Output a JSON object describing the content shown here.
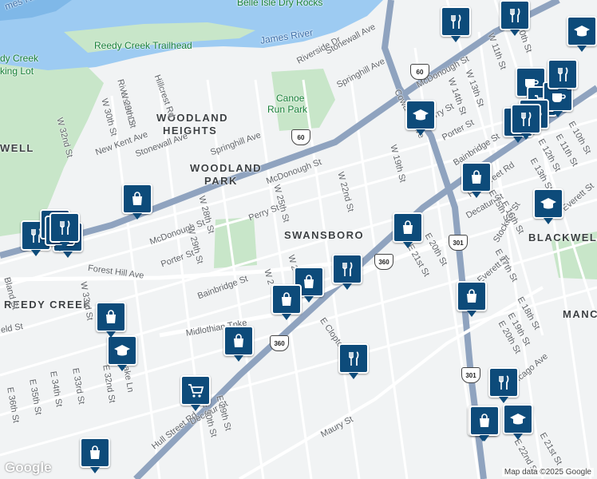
{
  "areas": [
    "WOODLAND HEIGHTS",
    "WOODLAND PARK",
    "SWANSBORO",
    "REEDY CREEK",
    "BLACKWELL",
    "MANC",
    "WELL"
  ],
  "pois": [
    "Reedy Creek Trailhead",
    "dy Creek",
    "king Lot",
    "Canoe Run Park",
    "Belle Isle Dry Rocks",
    "James River",
    "mes River"
  ],
  "streets": {
    "riverside_dr_1": "Riverside Dr",
    "riverside_dr_2": "Riverside Dr",
    "hillcrest": "Hillcrest Rd",
    "stonewall_ave_1": "Stonewall Ave",
    "stonewall_ave_2": "Stonewall Ave",
    "springhill_ave_1": "Springhill Ave",
    "springhill_ave_2": "Springhill Ave",
    "new_kent": "New Kent Ave",
    "mcdonough_1": "McDonough St",
    "mcdonough_2": "McDonough St",
    "mcdonough_3": "McDonough St",
    "perry_1": "Perry St",
    "perry_2": "Perry St",
    "porter_1": "Porter St",
    "porter_2": "Porter St",
    "bainbridge_1": "Bainbridge St",
    "bainbridge_2": "Bainbridge St",
    "forest_hill": "Forest Hill Ave",
    "midlothian": "Midlothian Tpke",
    "cowardin": "Cowardin Ave",
    "hull_1": "Hull Street Rd",
    "hull_2": "Hull Street Rd",
    "maury": "Maury St",
    "decatur_1": "Decatur St",
    "decatur_2": "Decatur St",
    "stockton": "Stockton St",
    "everett_1": "Everett St",
    "everett_2": "Everett St",
    "chicago": "Chicago Ave",
    "clopton": "E Clopton St",
    "w_32nd": "W 32nd St",
    "w_30th": "W 30th St",
    "w_29th_1": "W 29th St",
    "w_29th_2": "W 29th St",
    "w_28th": "W 28th St",
    "w_25th": "W 25th St",
    "w_22nd": "W 22nd St",
    "w_19th": "W 19th St",
    "w_14th": "W 14th St",
    "w_13th": "W 13th St",
    "w_11th": "W 11th St",
    "w_10th": "W 10th St",
    "e_10th": "E 10th St",
    "e_11th": "E 11th St",
    "e_12th": "E 12th St",
    "e_13th": "E 13th St",
    "e_15th": "E 15th St",
    "e_16th": "E 16th St",
    "e_17th": "E 17th St",
    "e_18th": "E 18th St",
    "e_19th": "E 19th St",
    "e_20th_1": "E 20th St",
    "e_20th_2": "E 20th St",
    "e_21st_1": "E 21st St",
    "e_21st_2": "E 21st St",
    "e_22nd": "E 22nd St",
    "e_29th": "E 29th St",
    "e_30th": "E 30th St",
    "e_32nd": "E 32nd St",
    "e_33rd": "E 33rd St",
    "e_34th": "E 34th St",
    "e_35th": "E 35th St",
    "e_36th": "E 36th St",
    "w_33rd": "W 33rd St",
    "w_2x": "W 2",
    "w_2x_b": "W 2",
    "bland": "Bland St",
    "blake": "Blake Ln",
    "field": "eld St",
    "st_frag": "St",
    "ave_frag": "Ave"
  },
  "shields": [
    "60",
    "60",
    "360",
    "360",
    "301",
    "301"
  ],
  "pins": [
    "shopping",
    "restaurant",
    "shopping",
    "restaurant",
    "shopping",
    "shopping",
    "restaurant",
    "shopping",
    "shopping",
    "school",
    "grocery",
    "school",
    "restaurant",
    "restaurant",
    "shopping",
    "cafe",
    "restaurant",
    "grocery",
    "cafe",
    "restaurant",
    "shopping",
    "school",
    "restaurant",
    "restaurant",
    "school",
    "shopping",
    "shopping",
    "restaurant",
    "shopping",
    "school",
    "shopping",
    "restaurant",
    "cafe",
    "restaurant"
  ],
  "attribution": "Map data ©2025 Google",
  "logo": "Google",
  "colors": {
    "water": "#9dcbf2",
    "park": "#c8e6c9",
    "road": "#8fa3bf",
    "pin": "#0d4b7a"
  }
}
